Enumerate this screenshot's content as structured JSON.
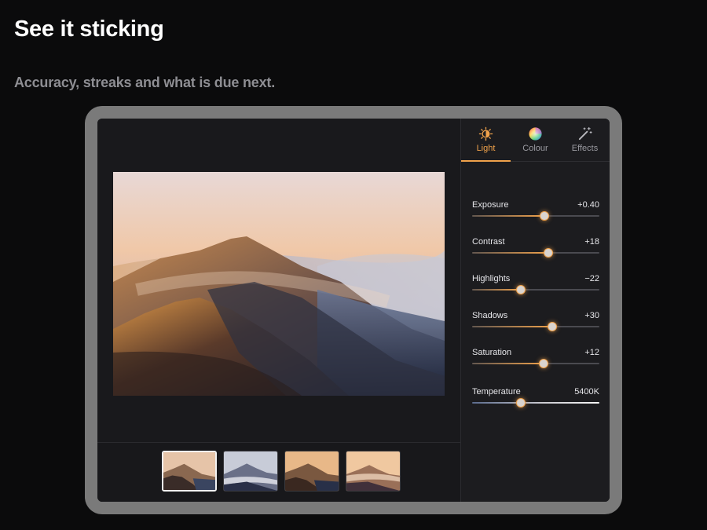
{
  "hero": {
    "title": "See it sticking",
    "subtitle": "Accuracy, streaks and what is due next."
  },
  "colors": {
    "accent": "#f0a24b",
    "background": "#0b0b0c",
    "device_frame": "#7a7a7a",
    "panel": "#1c1c1f"
  },
  "tabs": [
    {
      "label": "Light",
      "icon": "sun-contrast-icon",
      "active": true
    },
    {
      "label": "Colour",
      "icon": "color-wheel-icon",
      "active": false
    },
    {
      "label": "Effects",
      "icon": "magic-wand-icon",
      "active": false
    }
  ],
  "adjustments": [
    {
      "name": "Exposure",
      "value": "+0.40",
      "level": 0.57
    },
    {
      "name": "Contrast",
      "value": "+18",
      "level": 0.6
    },
    {
      "name": "Highlights",
      "value": "−22",
      "level": 0.38
    },
    {
      "name": "Shadows",
      "value": "+30",
      "level": 0.63
    },
    {
      "name": "Saturation",
      "value": "+12",
      "level": 0.56
    },
    {
      "name": "Temperature",
      "value": "5400K",
      "level": 0.38
    }
  ],
  "filmstrip": {
    "selected_index": 0,
    "count": 4
  }
}
